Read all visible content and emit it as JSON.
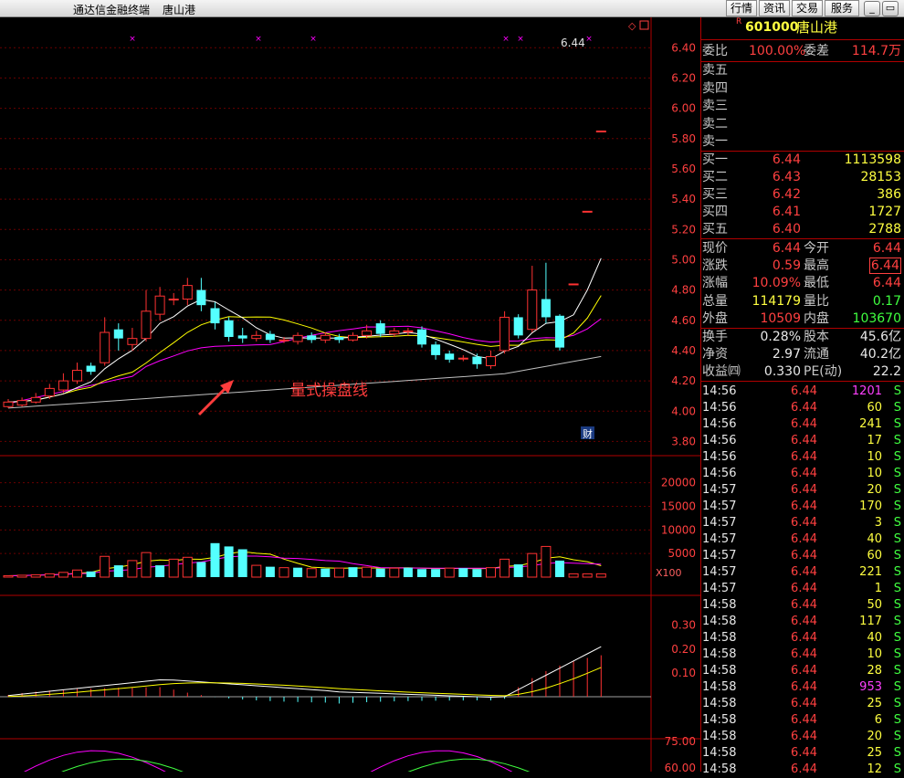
{
  "window": {
    "app_title": "通达信金融终端",
    "stock_name": "唐山港",
    "buttons": [
      "行情",
      "资讯",
      "交易",
      "服务"
    ],
    "win_buttons": [
      "_",
      "▭"
    ]
  },
  "quote": {
    "code": "601000",
    "name": "唐山港",
    "code_prefix": "R",
    "weibi_label": "委比",
    "weibi": "100.00%",
    "weicha_label": "委差",
    "weicha": "114.7万",
    "sell": [
      {
        "label": "卖五"
      },
      {
        "label": "卖四"
      },
      {
        "label": "卖三"
      },
      {
        "label": "卖二"
      },
      {
        "label": "卖一"
      }
    ],
    "buy": [
      {
        "label": "买一",
        "price": "6.44",
        "volume": "1113598"
      },
      {
        "label": "买二",
        "price": "6.43",
        "volume": "28153"
      },
      {
        "label": "买三",
        "price": "6.42",
        "volume": "386"
      },
      {
        "label": "买四",
        "price": "6.41",
        "volume": "1727"
      },
      {
        "label": "买五",
        "price": "6.40",
        "volume": "2788"
      }
    ],
    "stats": [
      {
        "l1": "现价",
        "v1": "6.44",
        "l2": "今开",
        "v2": "6.44"
      },
      {
        "l1": "涨跌",
        "v1": "0.59",
        "l2": "最高",
        "v2": "6.44"
      },
      {
        "l1": "涨幅",
        "v1": "10.09%",
        "l2": "最低",
        "v2": "6.44"
      },
      {
        "l1": "总量",
        "v1": "114179",
        "l2": "量比",
        "v2": "0.17"
      },
      {
        "l1": "外盘",
        "v1": "10509",
        "l2": "内盘",
        "v2": "103670"
      }
    ],
    "stats2": [
      {
        "l1": "换手",
        "v1": "0.28%",
        "l2": "股本",
        "v2": "45.6亿"
      },
      {
        "l1": "净资",
        "v1": "2.97",
        "l2": "流通",
        "v2": "40.2亿"
      },
      {
        "l1": "收益㈣",
        "v1": "0.330",
        "l2": "PE(动)",
        "v2": "22.2"
      }
    ]
  },
  "ticks": [
    {
      "time": "14:56",
      "price": "6.44",
      "vol": "1201",
      "side": "S"
    },
    {
      "time": "14:56",
      "price": "6.44",
      "vol": "60",
      "side": "S"
    },
    {
      "time": "14:56",
      "price": "6.44",
      "vol": "241",
      "side": "S"
    },
    {
      "time": "14:56",
      "price": "6.44",
      "vol": "17",
      "side": "S"
    },
    {
      "time": "14:56",
      "price": "6.44",
      "vol": "10",
      "side": "S"
    },
    {
      "time": "14:56",
      "price": "6.44",
      "vol": "10",
      "side": "S"
    },
    {
      "time": "14:57",
      "price": "6.44",
      "vol": "20",
      "side": "S"
    },
    {
      "time": "14:57",
      "price": "6.44",
      "vol": "170",
      "side": "S"
    },
    {
      "time": "14:57",
      "price": "6.44",
      "vol": "3",
      "side": "S"
    },
    {
      "time": "14:57",
      "price": "6.44",
      "vol": "40",
      "side": "S"
    },
    {
      "time": "14:57",
      "price": "6.44",
      "vol": "60",
      "side": "S"
    },
    {
      "time": "14:57",
      "price": "6.44",
      "vol": "221",
      "side": "S"
    },
    {
      "time": "14:57",
      "price": "6.44",
      "vol": "1",
      "side": "S"
    },
    {
      "time": "14:58",
      "price": "6.44",
      "vol": "50",
      "side": "S"
    },
    {
      "time": "14:58",
      "price": "6.44",
      "vol": "117",
      "side": "S"
    },
    {
      "time": "14:58",
      "price": "6.44",
      "vol": "40",
      "side": "S"
    },
    {
      "time": "14:58",
      "price": "6.44",
      "vol": "10",
      "side": "S"
    },
    {
      "time": "14:58",
      "price": "6.44",
      "vol": "28",
      "side": "S"
    },
    {
      "time": "14:58",
      "price": "6.44",
      "vol": "953",
      "side": "S"
    },
    {
      "time": "14:58",
      "price": "6.44",
      "vol": "25",
      "side": "S"
    },
    {
      "time": "14:58",
      "price": "6.44",
      "vol": "6",
      "side": "S"
    },
    {
      "time": "14:58",
      "price": "6.44",
      "vol": "20",
      "side": "S"
    },
    {
      "time": "14:58",
      "price": "6.44",
      "vol": "25",
      "side": "S"
    },
    {
      "time": "14:58",
      "price": "6.44",
      "vol": "12",
      "side": "S"
    }
  ],
  "chart_labels": {
    "annotation": "量式操盘线",
    "high_label": "6.44",
    "finance_marker": "财",
    "vol_unit": "X100"
  },
  "price_axis": [
    "6.40",
    "6.20",
    "6.00",
    "5.80",
    "5.60",
    "5.40",
    "5.20",
    "5.00",
    "4.80",
    "4.60",
    "4.40",
    "4.20",
    "4.00",
    "3.80"
  ],
  "vol_axis": [
    "20000",
    "15000",
    "10000",
    "5000"
  ],
  "macd_axis": [
    "0.30",
    "0.20",
    "0.10"
  ],
  "kdj_axis": [
    "75.00",
    "60.00"
  ],
  "colors": {
    "up": "#ff3232",
    "down": "#54ffff",
    "ma5": "#ffffff",
    "ma10": "#ffff00",
    "ma20": "#ff00ff",
    "ma60": "#c0c0c0",
    "grid": "#8b0000"
  },
  "chart_data": {
    "type": "candlestick",
    "candles": [
      {
        "o": 4.03,
        "c": 4.06,
        "h": 4.08,
        "l": 4.02
      },
      {
        "o": 4.04,
        "c": 4.07,
        "h": 4.09,
        "l": 4.03
      },
      {
        "o": 4.06,
        "c": 4.09,
        "h": 4.12,
        "l": 4.05
      },
      {
        "o": 4.1,
        "c": 4.15,
        "h": 4.18,
        "l": 4.08
      },
      {
        "o": 4.14,
        "c": 4.2,
        "h": 4.25,
        "l": 4.12
      },
      {
        "o": 4.2,
        "c": 4.27,
        "h": 4.32,
        "l": 4.18
      },
      {
        "o": 4.3,
        "c": 4.26,
        "h": 4.32,
        "l": 4.24
      },
      {
        "o": 4.32,
        "c": 4.52,
        "h": 4.62,
        "l": 4.3
      },
      {
        "o": 4.54,
        "c": 4.48,
        "h": 4.58,
        "l": 4.4
      },
      {
        "o": 4.44,
        "c": 4.48,
        "h": 4.55,
        "l": 4.4
      },
      {
        "o": 4.48,
        "c": 4.66,
        "h": 4.8,
        "l": 4.46
      },
      {
        "o": 4.64,
        "c": 4.76,
        "h": 4.82,
        "l": 4.6
      },
      {
        "o": 4.74,
        "c": 4.74,
        "h": 4.78,
        "l": 4.7
      },
      {
        "o": 4.74,
        "c": 4.83,
        "h": 4.88,
        "l": 4.7
      },
      {
        "o": 4.8,
        "c": 4.7,
        "h": 4.88,
        "l": 4.66
      },
      {
        "o": 4.68,
        "c": 4.58,
        "h": 4.72,
        "l": 4.54
      },
      {
        "o": 4.6,
        "c": 4.49,
        "h": 4.62,
        "l": 4.46
      },
      {
        "o": 4.5,
        "c": 4.48,
        "h": 4.55,
        "l": 4.45
      },
      {
        "o": 4.48,
        "c": 4.5,
        "h": 4.53,
        "l": 4.46
      },
      {
        "o": 4.51,
        "c": 4.47,
        "h": 4.53,
        "l": 4.45
      },
      {
        "o": 4.47,
        "c": 4.47,
        "h": 4.49,
        "l": 4.45
      },
      {
        "o": 4.46,
        "c": 4.5,
        "h": 4.52,
        "l": 4.44
      },
      {
        "o": 4.5,
        "c": 4.47,
        "h": 4.52,
        "l": 4.45
      },
      {
        "o": 4.47,
        "c": 4.5,
        "h": 4.52,
        "l": 4.45
      },
      {
        "o": 4.49,
        "c": 4.47,
        "h": 4.51,
        "l": 4.45
      },
      {
        "o": 4.47,
        "c": 4.5,
        "h": 4.52,
        "l": 4.46
      },
      {
        "o": 4.5,
        "c": 4.53,
        "h": 4.57,
        "l": 4.48
      },
      {
        "o": 4.58,
        "c": 4.51,
        "h": 4.6,
        "l": 4.49
      },
      {
        "o": 4.51,
        "c": 4.53,
        "h": 4.55,
        "l": 4.49
      },
      {
        "o": 4.53,
        "c": 4.53,
        "h": 4.55,
        "l": 4.5
      },
      {
        "o": 4.54,
        "c": 4.44,
        "h": 4.56,
        "l": 4.42
      },
      {
        "o": 4.44,
        "c": 4.37,
        "h": 4.46,
        "l": 4.34
      },
      {
        "o": 4.38,
        "c": 4.34,
        "h": 4.4,
        "l": 4.32
      },
      {
        "o": 4.35,
        "c": 4.35,
        "h": 4.37,
        "l": 4.33
      },
      {
        "o": 4.36,
        "c": 4.31,
        "h": 4.38,
        "l": 4.28
      },
      {
        "o": 4.3,
        "c": 4.36,
        "h": 4.4,
        "l": 4.28
      },
      {
        "o": 4.4,
        "c": 4.62,
        "h": 4.66,
        "l": 4.38
      },
      {
        "o": 4.62,
        "c": 4.5,
        "h": 4.64,
        "l": 4.48
      },
      {
        "o": 4.54,
        "c": 4.8,
        "h": 4.96,
        "l": 4.52
      },
      {
        "o": 4.74,
        "c": 4.62,
        "h": 4.98,
        "l": 4.58
      },
      {
        "o": 4.63,
        "c": 4.42,
        "h": 4.64,
        "l": 4.4
      },
      {
        "o": 4.84,
        "c": 4.84,
        "h": 4.84,
        "l": 4.84
      },
      {
        "o": 5.32,
        "c": 5.32,
        "h": 5.32,
        "l": 5.32
      },
      {
        "o": 5.85,
        "c": 5.85,
        "h": 5.85,
        "l": 5.85
      }
    ],
    "volumes": [
      300,
      400,
      500,
      700,
      1000,
      1500,
      1200,
      4400,
      2500,
      3500,
      5200,
      2500,
      3800,
      4200,
      3200,
      7200,
      6500,
      5900,
      2500,
      2200,
      2000,
      2000,
      1800,
      1800,
      1900,
      2100,
      2100,
      1800,
      1900,
      2000,
      1700,
      1700,
      1900,
      1900,
      1700,
      2000,
      3800,
      2700,
      5000,
      6500,
      3500,
      700,
      700,
      700
    ],
    "volume_colors": [
      "up",
      "up",
      "up",
      "up",
      "up",
      "up",
      "down",
      "up",
      "down",
      "up",
      "up",
      "down",
      "up",
      "up",
      "down",
      "down",
      "down",
      "down",
      "up",
      "down",
      "up",
      "down",
      "up",
      "down",
      "up",
      "down",
      "up",
      "down",
      "up",
      "down",
      "down",
      "down",
      "up",
      "down",
      "down",
      "up",
      "up",
      "down",
      "up",
      "up",
      "down",
      "up",
      "up",
      "up"
    ],
    "price_ylim": [
      3.7,
      6.48
    ],
    "volume_ylim": [
      0,
      24000
    ],
    "macd_ylim": [
      -0.08,
      0.36
    ]
  }
}
